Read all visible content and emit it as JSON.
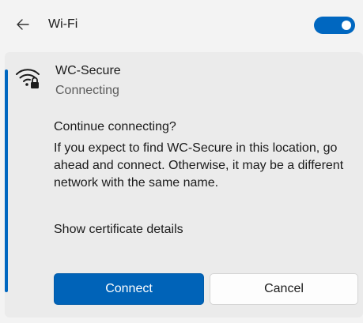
{
  "header": {
    "back_icon": "back-arrow-icon",
    "title": "Wi-Fi",
    "wifi_enabled": true
  },
  "network": {
    "icon": "wifi-secured-icon",
    "name": "WC-Secure",
    "status": "Connecting"
  },
  "prompt": {
    "question": "Continue connecting?",
    "explanation": "If you expect to find WC-Secure in this location, go ahead and connect. Otherwise, it may be a different network with the same name.",
    "certificate_link": "Show certificate details"
  },
  "buttons": {
    "connect_label": "Connect",
    "cancel_label": "Cancel"
  },
  "colors": {
    "accent": "#0067c0",
    "background": "#f3f3f3",
    "panel": "#ebebeb"
  }
}
